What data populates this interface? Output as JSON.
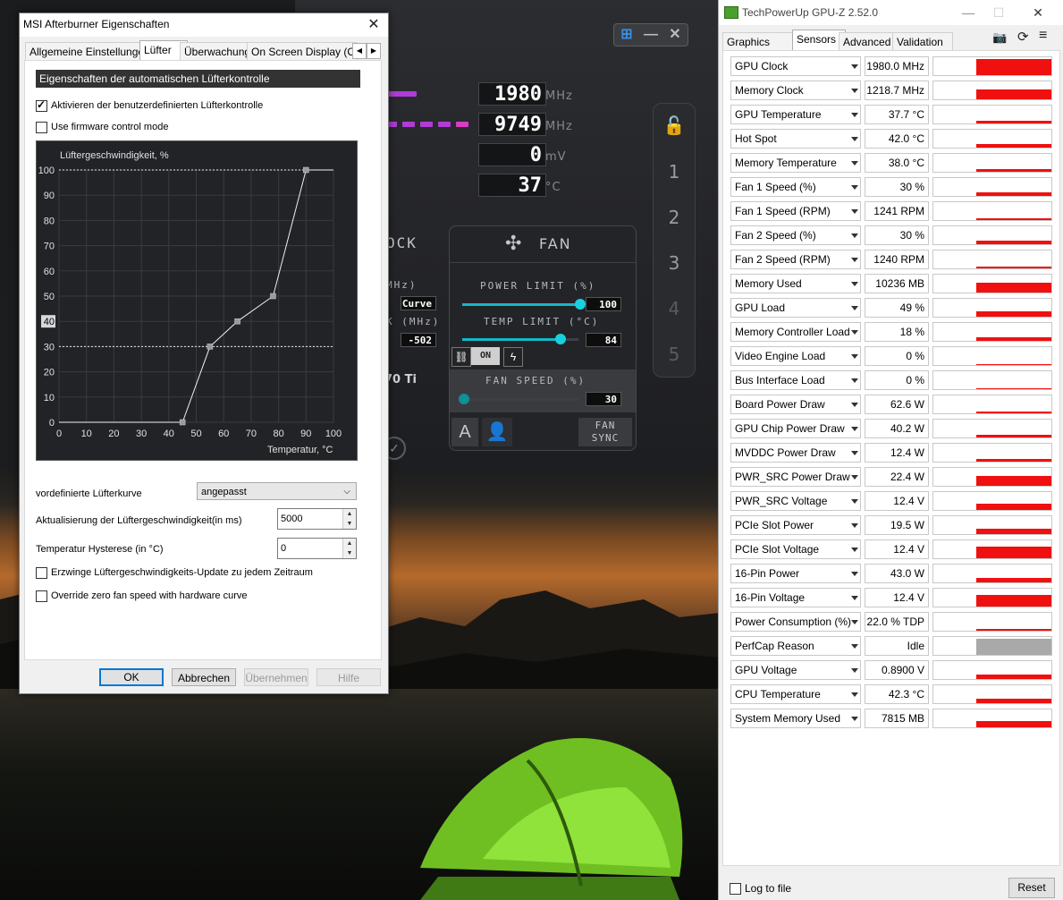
{
  "afterburner": {
    "rows": [
      {
        "value": "1980",
        "unit": "MHz"
      },
      {
        "value": "9749",
        "unit": "MHz"
      },
      {
        "value": "0",
        "unit": "mV"
      },
      {
        "value": "37",
        "unit": "°C"
      }
    ],
    "profiles": [
      "1",
      "2",
      "3",
      "4",
      "5"
    ],
    "clock_label": "OCK",
    "fan_label": "FAN",
    "mhz1": "MHz)",
    "mhz2": "K (MHz)",
    "curve_value": "Curve",
    "offset_value": "-502",
    "gpu_partial": "70 Ti",
    "power_limit_label": "POWER LIMIT (%)",
    "power_limit_value": "100",
    "temp_limit_label": "TEMP LIMIT (°C)",
    "temp_limit_value": "84",
    "link_on": "ON",
    "fan_speed_label": "FAN SPEED (%)",
    "fan_speed_value": "30",
    "fan_sync_label": "FAN SYNC",
    "auto_label": "A"
  },
  "dialog": {
    "title": "MSI Afterburner Eigenschaften",
    "tabs": [
      "Allgemeine Einstellungen",
      "Lüfter",
      "Überwachung",
      "On Screen Display (OS"
    ],
    "section_title": "Eigenschaften der automatischen Lüfterkontrolle",
    "cb_custom": "Aktivieren der benutzerdefinierten Lüfterkontrolle",
    "cb_firmware": "Use firmware control mode",
    "preset_label": "vordefinierte Lüfterkurve",
    "preset_value": "angepasst",
    "update_label": "Aktualisierung der Lüftergeschwindigkeit(in ms)",
    "update_value": "5000",
    "hyst_label": "Temperatur Hysterese (in °C)",
    "hyst_value": "0",
    "cb_force": "Erzwinge Lüftergeschwindigkeits-Update zu jedem Zeitraum",
    "cb_override": "Override zero fan speed with hardware curve",
    "btn_ok": "OK",
    "btn_cancel": "Abbrechen",
    "btn_apply": "Übernehmen",
    "btn_help": "Hilfe"
  },
  "chart_data": {
    "type": "line",
    "ylabel": "Lüftergeschwindigkeit, %",
    "xlabel": "Temperatur, °C",
    "xlim": [
      0,
      100
    ],
    "ylim": [
      0,
      100
    ],
    "xticks": [
      "0",
      "10",
      "20",
      "30",
      "40",
      "50",
      "60",
      "70",
      "80",
      "90",
      "100"
    ],
    "yticks": [
      "0",
      "10",
      "20",
      "30",
      "40",
      "50",
      "60",
      "70",
      "80",
      "90",
      "100"
    ],
    "x_highlight": "65",
    "y_highlight": "40",
    "series": [
      {
        "x": [
          0,
          45,
          55,
          65,
          78,
          90,
          100
        ],
        "y": [
          0,
          0,
          30,
          40,
          50,
          100,
          100
        ]
      }
    ],
    "hysteresis_lines_y": [
      100,
      30
    ],
    "grid": true
  },
  "gpuz": {
    "title": "TechPowerUp GPU-Z 2.52.0",
    "tabs": [
      "Graphics Card",
      "Sensors",
      "Advanced",
      "Validation"
    ],
    "sensors": [
      {
        "name": "GPU Clock",
        "value": "1980.0 MHz",
        "fill": 1.0
      },
      {
        "name": "Memory Clock",
        "value": "1218.7 MHz",
        "fill": 0.6
      },
      {
        "name": "GPU Temperature",
        "value": "37.7 °C",
        "fill": 0.15
      },
      {
        "name": "Hot Spot",
        "value": "42.0 °C",
        "fill": 0.2
      },
      {
        "name": "Memory Temperature",
        "value": "38.0 °C",
        "fill": 0.15
      },
      {
        "name": "Fan 1 Speed (%)",
        "value": "30 %",
        "fill": 0.2
      },
      {
        "name": "Fan 1 Speed (RPM)",
        "value": "1241 RPM",
        "fill": 0.1
      },
      {
        "name": "Fan 2 Speed (%)",
        "value": "30 %",
        "fill": 0.2
      },
      {
        "name": "Fan 2 Speed (RPM)",
        "value": "1240 RPM",
        "fill": 0.1
      },
      {
        "name": "Memory Used",
        "value": "10236 MB",
        "fill": 0.6
      },
      {
        "name": "GPU Load",
        "value": "49 %",
        "fill": 0.35
      },
      {
        "name": "Memory Controller Load",
        "value": "18 %",
        "fill": 0.2
      },
      {
        "name": "Video Engine Load",
        "value": "0 %",
        "fill": 0.0
      },
      {
        "name": "Bus Interface Load",
        "value": "0 %",
        "fill": 0.0
      },
      {
        "name": "Board Power Draw",
        "value": "62.6 W",
        "fill": 0.12
      },
      {
        "name": "GPU Chip Power Draw",
        "value": "40.2 W",
        "fill": 0.15
      },
      {
        "name": "MVDDC Power Draw",
        "value": "12.4 W",
        "fill": 0.18
      },
      {
        "name": "PWR_SRC Power Draw",
        "value": "22.4 W",
        "fill": 0.6
      },
      {
        "name": "PWR_SRC Voltage",
        "value": "12.4 V",
        "fill": 0.4
      },
      {
        "name": "PCIe Slot Power",
        "value": "19.5 W",
        "fill": 0.35
      },
      {
        "name": "PCIe Slot Voltage",
        "value": "12.4 V",
        "fill": 0.7
      },
      {
        "name": "16-Pin Power",
        "value": "43.0 W",
        "fill": 0.25
      },
      {
        "name": "16-Pin Voltage",
        "value": "12.4 V",
        "fill": 0.7
      },
      {
        "name": "Power Consumption (%)",
        "value": "22.0 % TDP",
        "fill": 0.12
      },
      {
        "name": "PerfCap Reason",
        "value": "Idle",
        "fill": 1.0,
        "color": "#a9a9a9"
      },
      {
        "name": "GPU Voltage",
        "value": "0.8900 V",
        "fill": 0.3
      },
      {
        "name": "CPU Temperature",
        "value": "42.3 °C",
        "fill": 0.25
      },
      {
        "name": "System Memory Used",
        "value": "7815 MB",
        "fill": 0.4
      }
    ],
    "log_label": "Log to file",
    "reset_label": "Reset"
  },
  "colors": {
    "sensor_bar": "#f01010",
    "fan_accent": "#19d0e0",
    "clock_bar": "#b03cd6"
  }
}
